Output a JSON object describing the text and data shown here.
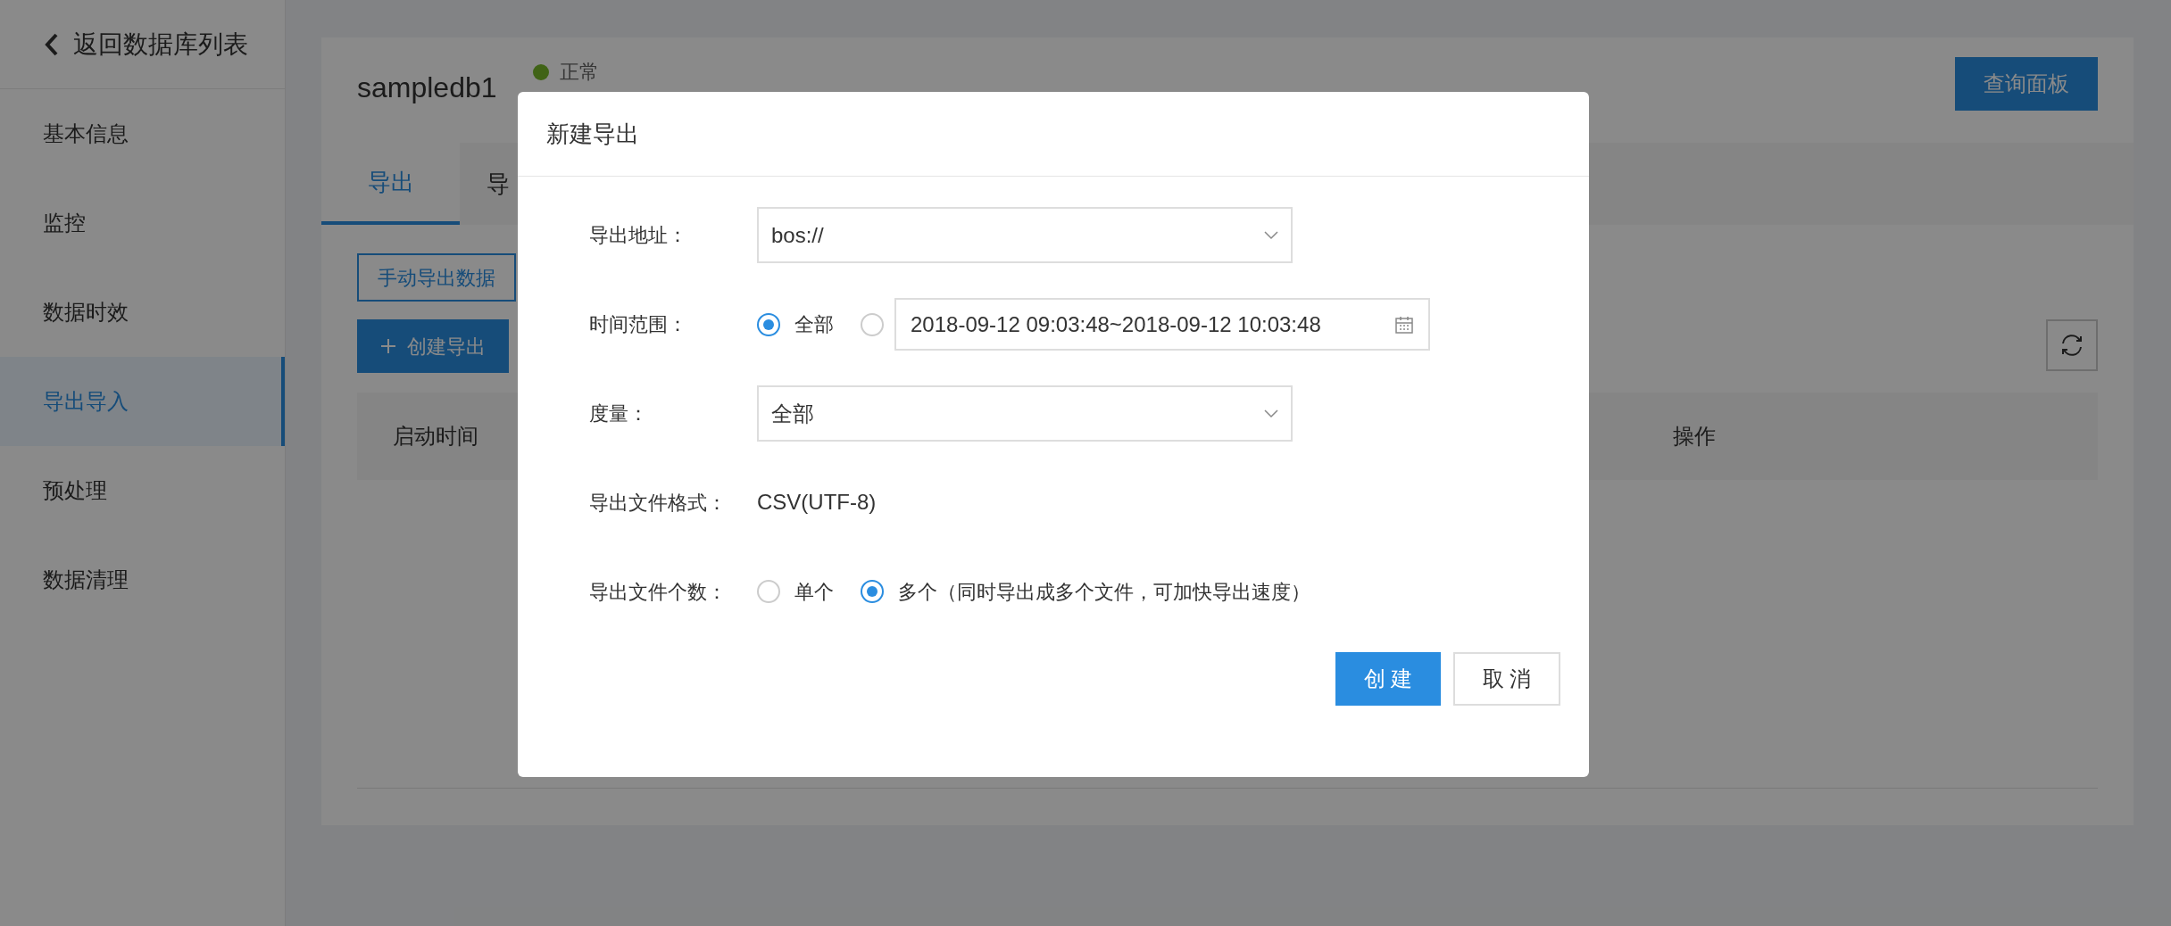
{
  "sidebar": {
    "back_link": "返回数据库列表",
    "items": [
      {
        "label": "基本信息",
        "selected": false
      },
      {
        "label": "监控",
        "selected": false
      },
      {
        "label": "数据时效",
        "selected": false
      },
      {
        "label": "导出导入",
        "selected": true
      },
      {
        "label": "预处理",
        "selected": false
      },
      {
        "label": "数据清理",
        "selected": false
      }
    ]
  },
  "header": {
    "db_name": "sampledb1",
    "status": "正常",
    "query_button": "查询面板"
  },
  "tabs": [
    {
      "label": "导出",
      "selected": true
    },
    {
      "label": "导",
      "selected": false
    }
  ],
  "toolbar": {
    "manual_export_button": "手动导出数据",
    "create_button": "创建导出"
  },
  "table": {
    "columns": [
      "启动时间",
      "操作"
    ]
  },
  "dialog": {
    "title": "新建导出",
    "address": {
      "label": "导出地址：",
      "value": "bos://"
    },
    "time_range": {
      "label": "时间范围：",
      "options": [
        {
          "label": "全部",
          "selected": true
        },
        {
          "selected": false
        }
      ],
      "range_value": "2018-09-12 09:03:48~2018-09-12 10:03:48"
    },
    "metric": {
      "label": "度量：",
      "value": "全部"
    },
    "format": {
      "label": "导出文件格式：",
      "value": "CSV(UTF-8)"
    },
    "file_count": {
      "label": "导出文件个数：",
      "options": [
        {
          "label": "单个",
          "selected": false
        },
        {
          "label": "多个（同时导出成多个文件，可加快导出速度）",
          "selected": true
        }
      ]
    },
    "buttons": [
      {
        "label": "创 建",
        "kind": "primary"
      },
      {
        "label": "取 消",
        "kind": "default"
      }
    ]
  }
}
